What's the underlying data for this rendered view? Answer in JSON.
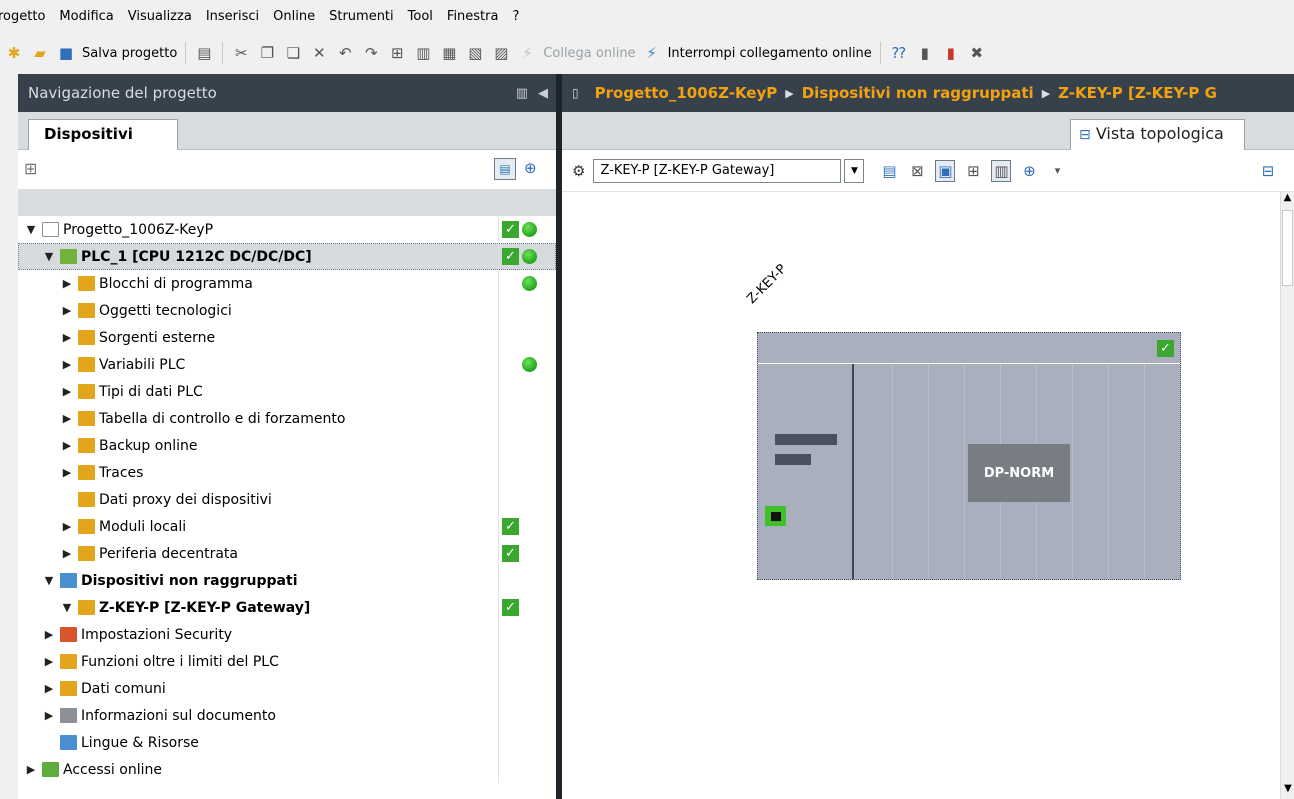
{
  "menu": [
    "rogetto",
    "Modifica",
    "Visualizza",
    "Inserisci",
    "Online",
    "Strumenti",
    "Tool",
    "Finestra",
    "?"
  ],
  "toolbar": {
    "save_label": "Salva progetto",
    "connect_online": "Collega online",
    "disconnect_online": "Interrompi collegamento online"
  },
  "left": {
    "header_title": "Navigazione del progetto",
    "tab": "Dispositivi",
    "tree": [
      {
        "label": "Progetto_1006Z-KeyP",
        "indent": 0,
        "arrow": "down",
        "bold": false,
        "icon": "project-icon",
        "icon_color": "#ffffff",
        "status": [
          "check",
          "dot"
        ]
      },
      {
        "label": "PLC_1 [CPU 1212C DC/DC/DC]",
        "indent": 1,
        "arrow": "down",
        "bold": true,
        "icon": "plc-icon",
        "icon_color": "#6fb33c",
        "status": [
          "check",
          "dot"
        ],
        "selected": true
      },
      {
        "label": "Blocchi di programma",
        "indent": 2,
        "arrow": "right",
        "bold": false,
        "icon": "program-blocks-icon",
        "icon_color": "#e2a51b",
        "status": [
          "dot"
        ]
      },
      {
        "label": "Oggetti tecnologici",
        "indent": 2,
        "arrow": "right",
        "bold": false,
        "icon": "technology-objects-icon",
        "icon_color": "#e2a51b",
        "status": []
      },
      {
        "label": "Sorgenti esterne",
        "indent": 2,
        "arrow": "right",
        "bold": false,
        "icon": "external-sources-icon",
        "icon_color": "#e2a51b",
        "status": []
      },
      {
        "label": "Variabili PLC",
        "indent": 2,
        "arrow": "right",
        "bold": false,
        "icon": "plc-tags-icon",
        "icon_color": "#e2a51b",
        "status": [
          "dot"
        ]
      },
      {
        "label": "Tipi di dati PLC",
        "indent": 2,
        "arrow": "right",
        "bold": false,
        "icon": "plc-data-types-icon",
        "icon_color": "#e2a51b",
        "status": []
      },
      {
        "label": "Tabella di controllo e di forzamento",
        "indent": 2,
        "arrow": "right",
        "bold": false,
        "icon": "watch-table-icon",
        "icon_color": "#e2a51b",
        "status": []
      },
      {
        "label": "Backup online",
        "indent": 2,
        "arrow": "right",
        "bold": false,
        "icon": "backup-icon",
        "icon_color": "#e2a51b",
        "status": []
      },
      {
        "label": "Traces",
        "indent": 2,
        "arrow": "right",
        "bold": false,
        "icon": "traces-icon",
        "icon_color": "#e2a51b",
        "status": []
      },
      {
        "label": "Dati proxy dei dispositivi",
        "indent": 2,
        "arrow": "none",
        "bold": false,
        "icon": "proxy-data-icon",
        "icon_color": "#e2a51b",
        "status": []
      },
      {
        "label": "Moduli locali",
        "indent": 2,
        "arrow": "right",
        "bold": false,
        "icon": "local-modules-icon",
        "icon_color": "#e2a51b",
        "status": [
          "check"
        ]
      },
      {
        "label": "Periferia decentrata",
        "indent": 2,
        "arrow": "right",
        "bold": false,
        "icon": "distributed-io-icon",
        "icon_color": "#e2a51b",
        "status": [
          "check"
        ]
      },
      {
        "label": "Dispositivi non raggruppati",
        "indent": 1,
        "arrow": "down",
        "bold": true,
        "icon": "ungrouped-devices-icon",
        "icon_color": "#4a8fd0",
        "status": []
      },
      {
        "label": "Z-KEY-P [Z-KEY-P Gateway]",
        "indent": 2,
        "arrow": "down",
        "bold": true,
        "icon": "gateway-icon",
        "icon_color": "#e2a51b",
        "status": [
          "check"
        ]
      },
      {
        "label": "Impostazioni Security",
        "indent": 1,
        "arrow": "right",
        "bold": false,
        "icon": "security-icon",
        "icon_color": "#d9552b",
        "status": []
      },
      {
        "label": "Funzioni oltre i limiti del PLC",
        "indent": 1,
        "arrow": "right",
        "bold": false,
        "icon": "cross-plc-icon",
        "icon_color": "#e2a51b",
        "status": []
      },
      {
        "label": "Dati comuni",
        "indent": 1,
        "arrow": "right",
        "bold": false,
        "icon": "common-data-icon",
        "icon_color": "#e2a51b",
        "status": []
      },
      {
        "label": "Informazioni sul documento",
        "indent": 1,
        "arrow": "right",
        "bold": false,
        "icon": "document-info-icon",
        "icon_color": "#8a9096",
        "status": []
      },
      {
        "label": "Lingue & Risorse",
        "indent": 1,
        "arrow": "none",
        "bold": false,
        "icon": "languages-icon",
        "icon_color": "#4a8fd0",
        "status": []
      },
      {
        "label": "Accessi online",
        "indent": 0,
        "arrow": "right",
        "bold": false,
        "icon": "online-access-icon",
        "icon_color": "#5fae3d",
        "status": []
      }
    ]
  },
  "right": {
    "breadcrumb": [
      "Progetto_1006Z-KeyP",
      "Dispositivi non raggruppati",
      "Z-KEY-P [Z-KEY-P G"
    ],
    "tab": "Vista topologica",
    "device_select": "Z-KEY-P [Z-KEY-P Gateway]",
    "device_name": "Z-KEY-P",
    "module_label": "DP-NORM"
  }
}
